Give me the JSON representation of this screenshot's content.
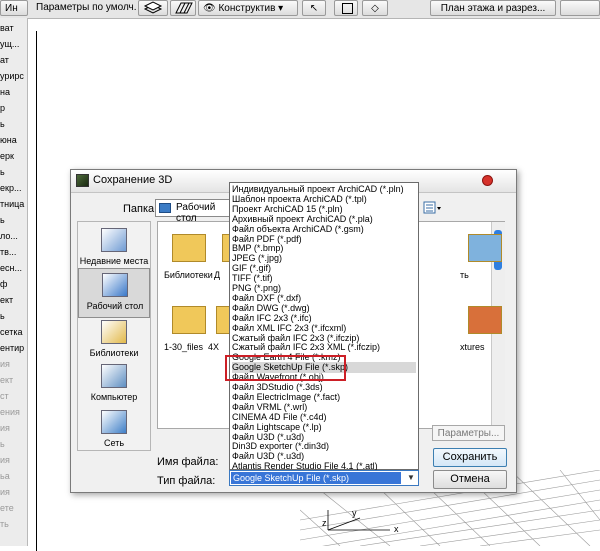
{
  "toolbar": {
    "left_label": "Ин",
    "default_params": "Параметры по умолч.",
    "view_mode": "Конструктив",
    "floor_plan_tab": "План этажа и разрез..."
  },
  "left_strip": {
    "items": [
      {
        "label": "ват",
        "dim": false
      },
      {
        "label": "ущ...",
        "dim": false
      },
      {
        "label": "ат",
        "dim": false
      },
      {
        "label": "урирс",
        "dim": false
      },
      {
        "label": "на",
        "dim": false
      },
      {
        "label": "р",
        "dim": false
      },
      {
        "label": "ь",
        "dim": false
      },
      {
        "label": "юна",
        "dim": false
      },
      {
        "label": "ерк",
        "dim": false
      },
      {
        "label": "ь",
        "dim": false
      },
      {
        "label": "екр...",
        "dim": false
      },
      {
        "label": "тница",
        "dim": false
      },
      {
        "label": "ь",
        "dim": false
      },
      {
        "label": "ло...",
        "dim": false
      },
      {
        "label": "тв...",
        "dim": false
      },
      {
        "label": "есн...",
        "dim": false
      },
      {
        "label": "ф",
        "dim": false
      },
      {
        "label": "ект",
        "dim": false
      },
      {
        "label": "ь",
        "dim": false
      },
      {
        "label": "сетка",
        "dim": false
      },
      {
        "label": "ентир",
        "dim": false
      },
      {
        "label": "ия",
        "dim": true
      },
      {
        "label": "ект",
        "dim": true
      },
      {
        "label": "ст",
        "dim": true
      },
      {
        "label": "ения",
        "dim": true
      },
      {
        "label": "ия",
        "dim": true
      },
      {
        "label": "ь",
        "dim": true
      },
      {
        "label": "ия",
        "dim": true
      },
      {
        "label": "ьа",
        "dim": true
      },
      {
        "label": "ия",
        "dim": true
      },
      {
        "label": "ете",
        "dim": true
      },
      {
        "label": "ть",
        "dim": true
      }
    ]
  },
  "dialog": {
    "title": "Сохранение 3D",
    "folder_label": "Папка:",
    "folder_value": "Рабочий стол",
    "places": [
      {
        "label": "Недавние места",
        "icon": "recent-places-icon"
      },
      {
        "label": "Рабочий стол",
        "icon": "desktop-icon"
      },
      {
        "label": "Библиотеки",
        "icon": "libraries-icon"
      },
      {
        "label": "Компьютер",
        "icon": "computer-icon"
      },
      {
        "label": "Сеть",
        "icon": "network-icon"
      }
    ],
    "files": [
      {
        "label": "Библиотеки",
        "icon": "libraries-folder-icon"
      },
      {
        "label": "Д",
        "icon": "folder-icon"
      },
      {
        "label": "1-30_files",
        "icon": "folder-icon"
      },
      {
        "label": "4X",
        "icon": "folder-icon"
      },
      {
        "label": "ть",
        "icon": "network-folder-icon"
      },
      {
        "label": "xtures",
        "icon": "texture-folder-icon"
      }
    ],
    "params_button": "Параметры...",
    "filename_label": "Имя файла:",
    "filetype_label": "Тип файла:",
    "save_button": "Сохранить",
    "cancel_button": "Отмена",
    "file_types": [
      "Индивидуальный проект ArchiCAD (*.pln)",
      "Шаблон проекта ArchiCAD (*.tpl)",
      "Проект ArchiCAD 15 (*.pln)",
      "Архивный проект ArchiCAD (*.pla)",
      "Файл объекта ArchiCAD (*.gsm)",
      "Файл PDF (*.pdf)",
      "BMP (*.bmp)",
      "JPEG (*.jpg)",
      "GIF (*.gif)",
      "TIFF (*.tif)",
      "PNG (*.png)",
      "Файл DXF (*.dxf)",
      "Файл DWG (*.dwg)",
      "Файл IFC 2x3 (*.ifc)",
      "Файл XML IFC 2x3 (*.ifcxml)",
      "Сжатый файл IFC 2x3 (*.ifczip)",
      "Сжатый файл IFC 2x3 XML (*.ifczip)",
      "Google Earth 4 File (*.kmz)",
      "Google SketchUp File (*.skp)",
      "Файл Wavefront (*.obj)",
      "Файл 3DStudio (*.3ds)",
      "Файл ElectricImage (*.fact)",
      "Файл VRML (*.wrl)",
      "CINEMA 4D File (*.c4d)",
      "Файл Lightscape (*.lp)",
      "Файл U3D (*.u3d)",
      "Din3D exporter (*.din3d)",
      "Файл U3D (*.u3d)",
      "Atlantis Render Studio File 4.1 (*.atl)"
    ],
    "highlighted_index": 18,
    "selected_type": "Google SketchUp File (*.skp)"
  },
  "axis": {
    "x": "x",
    "y": "y",
    "z": "z"
  },
  "colors": {
    "highlight_box": "#cc1f26",
    "selection": "#3875d7",
    "scroll_thumb": "#2f7fe0"
  }
}
